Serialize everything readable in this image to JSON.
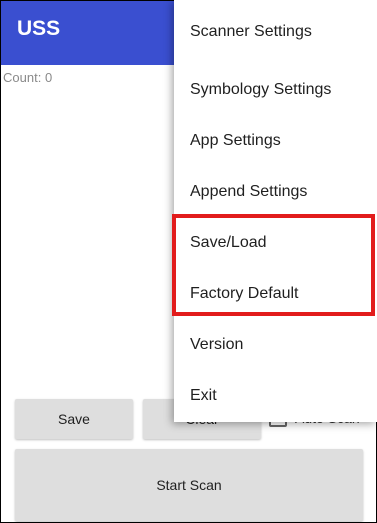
{
  "app": {
    "title": "USS",
    "count_label": "Count:",
    "count_value": "0"
  },
  "buttons": {
    "save": "Save",
    "clear": "Clear",
    "auto_scan": "Auto Scan",
    "start_scan": "Start Scan"
  },
  "menu": {
    "items": [
      {
        "label": "Scanner Settings"
      },
      {
        "label": "Symbology Settings"
      },
      {
        "label": "App Settings"
      },
      {
        "label": "Append Settings"
      },
      {
        "label": "Save/Load"
      },
      {
        "label": "Factory Default"
      },
      {
        "label": "Version"
      },
      {
        "label": "Exit"
      }
    ]
  },
  "colors": {
    "app_bar": "#3a4fd0",
    "highlight": "#e21c1c"
  }
}
